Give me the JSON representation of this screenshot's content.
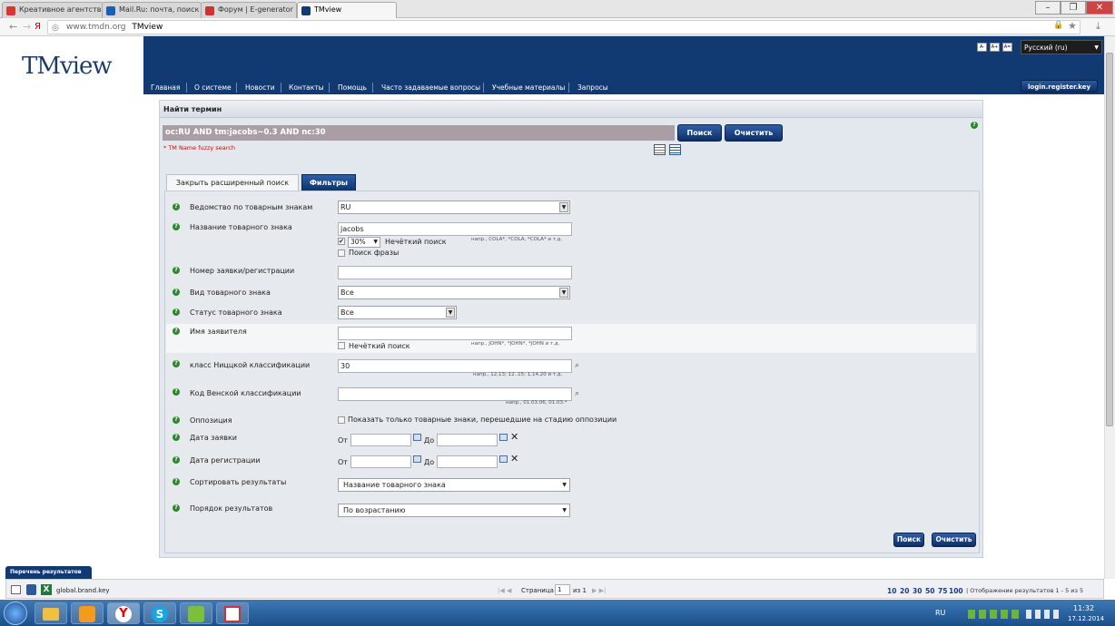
{
  "browser": {
    "tabs": [
      "Креативное агентство I",
      "Mail.Ru: почта, поиск в",
      "Форум | E-generator",
      "TMview"
    ],
    "url_domain": "www.tmdn.org",
    "url_title": "TMview",
    "nav_back": "←",
    "nav_forward": "→",
    "menu_char": "Я"
  },
  "site": {
    "logo": "TMview",
    "nav": [
      "Главная",
      "О системе",
      "Новости",
      "Контакты",
      "Помощь",
      "Часто задаваемые вопросы",
      "Учебные материалы",
      "Запросы"
    ],
    "font_buttons": [
      "A-",
      "A+",
      "A="
    ],
    "language": "Русский (ru)",
    "login": "login.register.key"
  },
  "search": {
    "title": "Найти термин",
    "query": "oc:RU AND tm:jacobs~0.3 AND nc:30",
    "search_btn": "Поиск",
    "clear_btn": "Очистить",
    "fuzzy_hint": "* TM Name fuzzy search",
    "tabs": [
      "Закрыть расширенный поиск",
      "Фильтры"
    ]
  },
  "form": {
    "office": {
      "label": "Ведомство по товарным знакам",
      "value": "RU"
    },
    "tm_name": {
      "label": "Название товарного знака",
      "value": "jacobs",
      "fuzzy_pct": "30%",
      "fuzzy_label": "Нечёткий поиск",
      "phrase_label": "Поиск фразы",
      "hint": "напр., COLA*, *COLA, *COLA* и т.д."
    },
    "app_number": {
      "label": "Номер заявки/регистрации",
      "value": ""
    },
    "tm_type": {
      "label": "Вид товарного знака",
      "value": "Все"
    },
    "tm_status": {
      "label": "Статус товарного знака",
      "value": "Все"
    },
    "applicant": {
      "label": "Имя заявителя",
      "value": "",
      "fuzzy_label": "Нечёткий поиск",
      "hint": "напр., JOHN*, *JOHN*, *JOHN и т.д."
    },
    "nice": {
      "label": "класс Ниццкой классификации",
      "value": "30",
      "hint": "напр., 12,13; 12..15; 1,14,20 и т.д."
    },
    "vienna": {
      "label": "Код Венской классификации",
      "value": "",
      "hint": "напр., 01.03.06, 01.03.*"
    },
    "opposition": {
      "label": "Оппозиция",
      "checkbox_label": "Показать только товарные знаки, перешедшие на стадию оппозиции"
    },
    "app_date": {
      "label": "Дата заявки",
      "from": "От",
      "to": "До"
    },
    "reg_date": {
      "label": "Дата регистрации",
      "from": "От",
      "to": "До"
    },
    "sort": {
      "label": "Сортировать результаты",
      "value": "Название товарного знака"
    },
    "order": {
      "label": "Порядок результатов",
      "value": "По возрастанию"
    },
    "search_btn": "Поиск",
    "clear_btn": "Очистить"
  },
  "results": {
    "tab": "Перечень результатов",
    "file": "global.brand.key",
    "page_label": "Страница",
    "page_value": "1",
    "of_label": "из 1",
    "page_sizes": [
      "10",
      "20",
      "30",
      "50",
      "75",
      "100"
    ],
    "summary": "| Отображение результатов 1 - 5 из 5"
  },
  "taskbar": {
    "lang": "RU",
    "time": "11:32",
    "date": "17.12.2014"
  },
  "colors": {
    "header": "#123a72",
    "button": "#1a4387",
    "query_bg": "#a89ea3"
  }
}
